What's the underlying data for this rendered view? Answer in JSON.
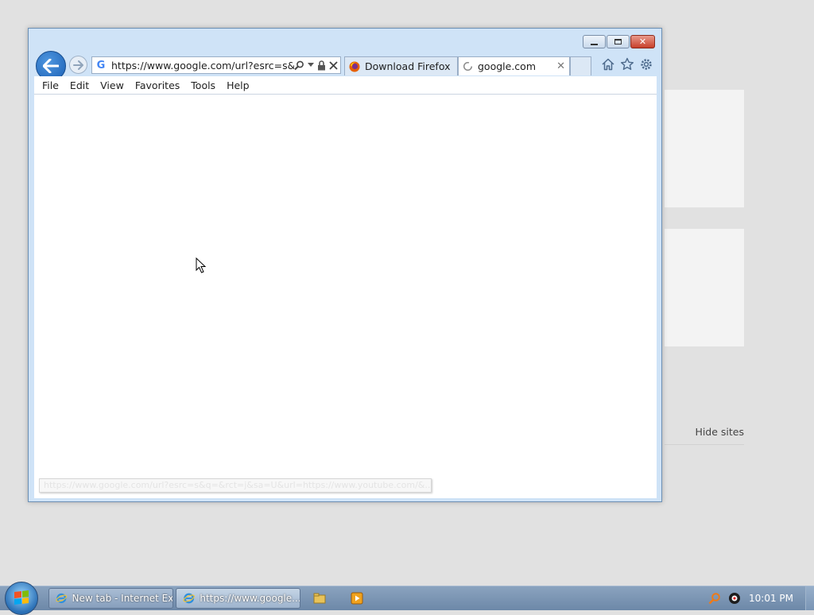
{
  "background": {
    "hide_sites_label": "Hide sites"
  },
  "window": {
    "caption_buttons": [
      "minimize-icon",
      "maximize-icon",
      "close-icon"
    ],
    "address_bar": {
      "value": "https://www.google.com/url?esrc=s&q=&",
      "icons": [
        "search-icon",
        "dropdown-icon",
        "lock-icon",
        "stop-icon"
      ]
    },
    "tabs": [
      {
        "label": "Download Firefox B...",
        "icon": "firefox-icon",
        "active": false
      },
      {
        "label": "google.com",
        "icon": "loading-icon",
        "active": true
      }
    ],
    "toolbar_icons": [
      "home-icon",
      "favorites-star-icon",
      "settings-gear-icon"
    ],
    "menu": [
      "File",
      "Edit",
      "View",
      "Favorites",
      "Tools",
      "Help"
    ],
    "status_url": "https://www.google.com/url?esrc=s&q=&rct=j&sa=U&url=https://www.youtube.com/&..."
  },
  "taskbar": {
    "buttons": [
      {
        "label": "New tab - Internet Ex...",
        "icon": "internet-explorer-icon",
        "active": false
      },
      {
        "label": "https://www.google....",
        "icon": "internet-explorer-icon",
        "active": true
      }
    ],
    "clock": "10:01 PM"
  },
  "colors": {
    "accent": "#1a5fb4",
    "window_frame": "#cfe3f7",
    "close_red": "#c7402a",
    "taskbar": "#7a95b5"
  }
}
